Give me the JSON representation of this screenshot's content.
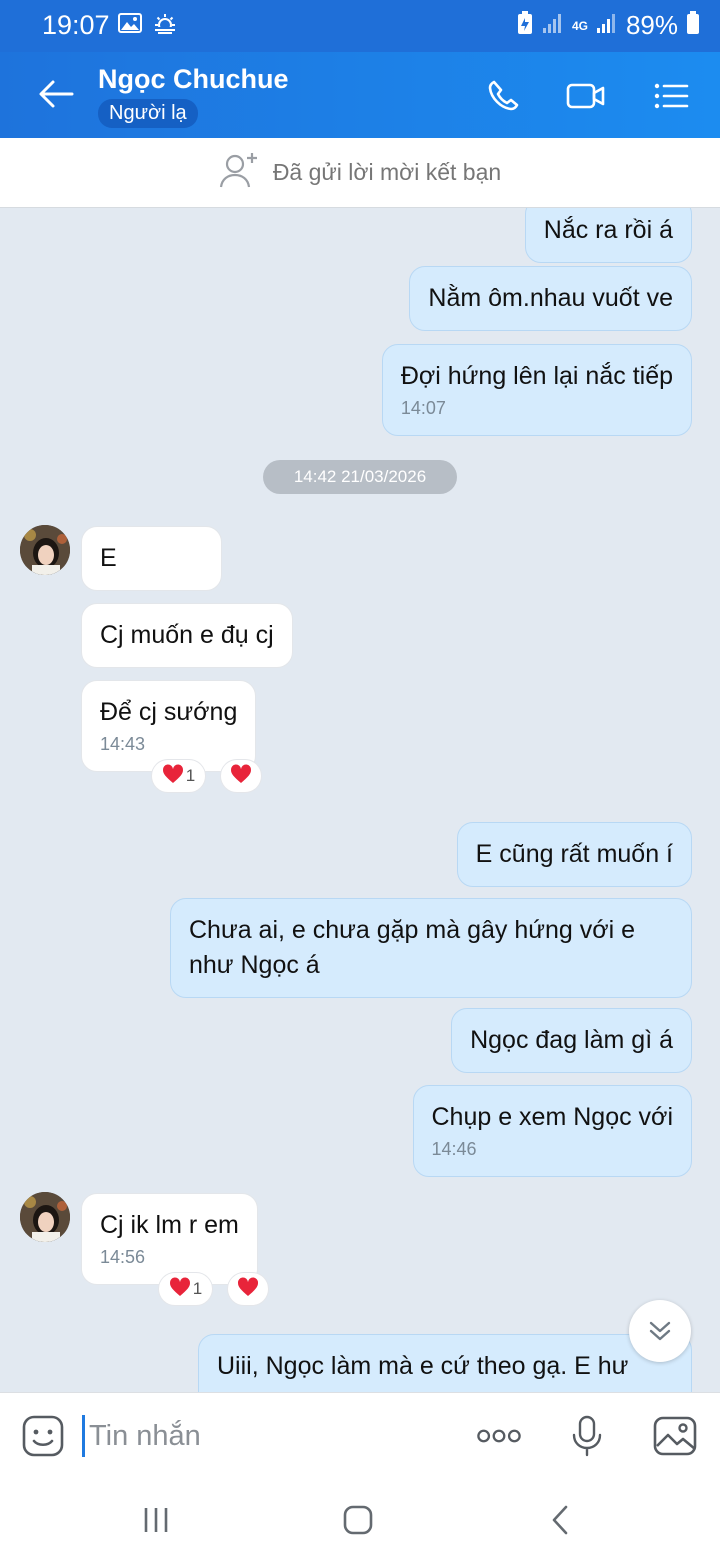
{
  "status": {
    "time": "19:07",
    "battery": "89%",
    "network": "4G"
  },
  "header": {
    "name": "Ngọc Chuchue",
    "badge": "Người lạ"
  },
  "friend_request": {
    "text": "Đã gửi lời mời kết bạn"
  },
  "date_divider": "14:42 21/03/2026",
  "messages": [
    {
      "from": "me",
      "text": "Nắc ra rồi á",
      "time": ""
    },
    {
      "from": "me",
      "text": "Nằm ôm.nhau vuốt ve",
      "time": ""
    },
    {
      "from": "me",
      "text": "Đợi hứng lên lại nắc tiếp",
      "time": "14:07"
    },
    {
      "from": "them",
      "text": "E",
      "time": ""
    },
    {
      "from": "them",
      "text": "Cj muốn e đụ cj",
      "time": ""
    },
    {
      "from": "them",
      "text": "Để cj sướng",
      "time": "14:43",
      "reaction_count": "1"
    },
    {
      "from": "me",
      "text": "E cũng rất muốn í",
      "time": ""
    },
    {
      "from": "me",
      "text": "Chưa ai, e chưa gặp mà gây hứng với e như Ngọc á",
      "time": ""
    },
    {
      "from": "me",
      "text": "Ngọc đag làm gì á",
      "time": ""
    },
    {
      "from": "me",
      "text": "Chụp e xem Ngọc với",
      "time": "14:46"
    },
    {
      "from": "them",
      "text": "Cj ik lm r em",
      "time": "14:56",
      "reaction_count": "1"
    },
    {
      "from": "me",
      "text": "Uiii, Ngọc làm mà e cứ theo gạ. E hư",
      "time": ""
    }
  ],
  "input": {
    "placeholder": "Tin nhắn"
  },
  "colors": {
    "header": "#1e73dc",
    "my_bubble": "#d5ebfd",
    "their_bubble": "#ffffff",
    "heart": "#e8243a"
  }
}
